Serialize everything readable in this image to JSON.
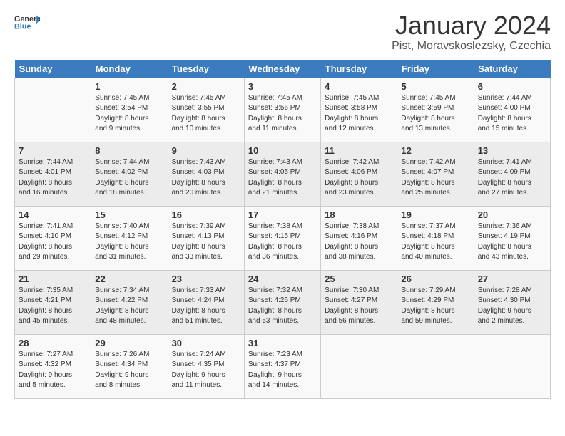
{
  "header": {
    "logo_general": "General",
    "logo_blue": "Blue",
    "month_title": "January 2024",
    "location": "Pist, Moravskoslezsky, Czechia"
  },
  "days_of_week": [
    "Sunday",
    "Monday",
    "Tuesday",
    "Wednesday",
    "Thursday",
    "Friday",
    "Saturday"
  ],
  "weeks": [
    [
      {
        "day": "",
        "info": ""
      },
      {
        "day": "1",
        "info": "Sunrise: 7:45 AM\nSunset: 3:54 PM\nDaylight: 8 hours\nand 9 minutes."
      },
      {
        "day": "2",
        "info": "Sunrise: 7:45 AM\nSunset: 3:55 PM\nDaylight: 8 hours\nand 10 minutes."
      },
      {
        "day": "3",
        "info": "Sunrise: 7:45 AM\nSunset: 3:56 PM\nDaylight: 8 hours\nand 11 minutes."
      },
      {
        "day": "4",
        "info": "Sunrise: 7:45 AM\nSunset: 3:58 PM\nDaylight: 8 hours\nand 12 minutes."
      },
      {
        "day": "5",
        "info": "Sunrise: 7:45 AM\nSunset: 3:59 PM\nDaylight: 8 hours\nand 13 minutes."
      },
      {
        "day": "6",
        "info": "Sunrise: 7:44 AM\nSunset: 4:00 PM\nDaylight: 8 hours\nand 15 minutes."
      }
    ],
    [
      {
        "day": "7",
        "info": "Sunrise: 7:44 AM\nSunset: 4:01 PM\nDaylight: 8 hours\nand 16 minutes."
      },
      {
        "day": "8",
        "info": "Sunrise: 7:44 AM\nSunset: 4:02 PM\nDaylight: 8 hours\nand 18 minutes."
      },
      {
        "day": "9",
        "info": "Sunrise: 7:43 AM\nSunset: 4:03 PM\nDaylight: 8 hours\nand 20 minutes."
      },
      {
        "day": "10",
        "info": "Sunrise: 7:43 AM\nSunset: 4:05 PM\nDaylight: 8 hours\nand 21 minutes."
      },
      {
        "day": "11",
        "info": "Sunrise: 7:42 AM\nSunset: 4:06 PM\nDaylight: 8 hours\nand 23 minutes."
      },
      {
        "day": "12",
        "info": "Sunrise: 7:42 AM\nSunset: 4:07 PM\nDaylight: 8 hours\nand 25 minutes."
      },
      {
        "day": "13",
        "info": "Sunrise: 7:41 AM\nSunset: 4:09 PM\nDaylight: 8 hours\nand 27 minutes."
      }
    ],
    [
      {
        "day": "14",
        "info": "Sunrise: 7:41 AM\nSunset: 4:10 PM\nDaylight: 8 hours\nand 29 minutes."
      },
      {
        "day": "15",
        "info": "Sunrise: 7:40 AM\nSunset: 4:12 PM\nDaylight: 8 hours\nand 31 minutes."
      },
      {
        "day": "16",
        "info": "Sunrise: 7:39 AM\nSunset: 4:13 PM\nDaylight: 8 hours\nand 33 minutes."
      },
      {
        "day": "17",
        "info": "Sunrise: 7:38 AM\nSunset: 4:15 PM\nDaylight: 8 hours\nand 36 minutes."
      },
      {
        "day": "18",
        "info": "Sunrise: 7:38 AM\nSunset: 4:16 PM\nDaylight: 8 hours\nand 38 minutes."
      },
      {
        "day": "19",
        "info": "Sunrise: 7:37 AM\nSunset: 4:18 PM\nDaylight: 8 hours\nand 40 minutes."
      },
      {
        "day": "20",
        "info": "Sunrise: 7:36 AM\nSunset: 4:19 PM\nDaylight: 8 hours\nand 43 minutes."
      }
    ],
    [
      {
        "day": "21",
        "info": "Sunrise: 7:35 AM\nSunset: 4:21 PM\nDaylight: 8 hours\nand 45 minutes."
      },
      {
        "day": "22",
        "info": "Sunrise: 7:34 AM\nSunset: 4:22 PM\nDaylight: 8 hours\nand 48 minutes."
      },
      {
        "day": "23",
        "info": "Sunrise: 7:33 AM\nSunset: 4:24 PM\nDaylight: 8 hours\nand 51 minutes."
      },
      {
        "day": "24",
        "info": "Sunrise: 7:32 AM\nSunset: 4:26 PM\nDaylight: 8 hours\nand 53 minutes."
      },
      {
        "day": "25",
        "info": "Sunrise: 7:30 AM\nSunset: 4:27 PM\nDaylight: 8 hours\nand 56 minutes."
      },
      {
        "day": "26",
        "info": "Sunrise: 7:29 AM\nSunset: 4:29 PM\nDaylight: 8 hours\nand 59 minutes."
      },
      {
        "day": "27",
        "info": "Sunrise: 7:28 AM\nSunset: 4:30 PM\nDaylight: 9 hours\nand 2 minutes."
      }
    ],
    [
      {
        "day": "28",
        "info": "Sunrise: 7:27 AM\nSunset: 4:32 PM\nDaylight: 9 hours\nand 5 minutes."
      },
      {
        "day": "29",
        "info": "Sunrise: 7:26 AM\nSunset: 4:34 PM\nDaylight: 9 hours\nand 8 minutes."
      },
      {
        "day": "30",
        "info": "Sunrise: 7:24 AM\nSunset: 4:35 PM\nDaylight: 9 hours\nand 11 minutes."
      },
      {
        "day": "31",
        "info": "Sunrise: 7:23 AM\nSunset: 4:37 PM\nDaylight: 9 hours\nand 14 minutes."
      },
      {
        "day": "",
        "info": ""
      },
      {
        "day": "",
        "info": ""
      },
      {
        "day": "",
        "info": ""
      }
    ]
  ]
}
